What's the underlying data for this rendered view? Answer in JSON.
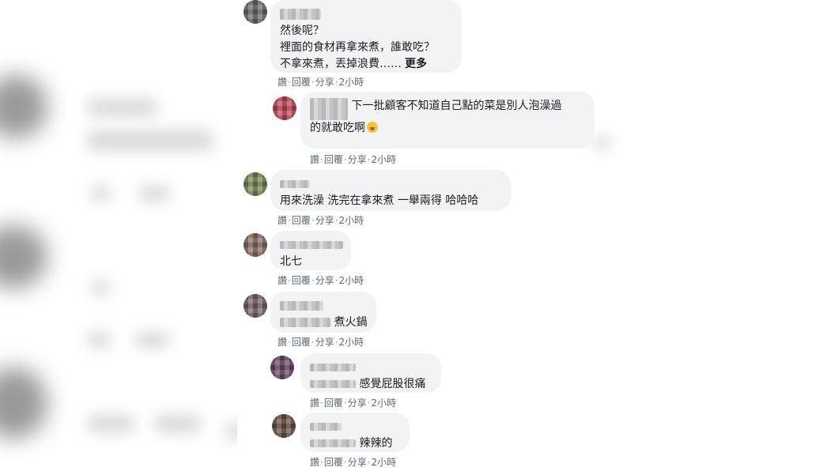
{
  "comments": [
    {
      "id": "c1",
      "lines": [
        "然後呢？",
        "裡面的食材再拿來煮，誰敢吃？",
        "不拿來煮，丟掉浪費……"
      ],
      "more": "更多",
      "actions": {
        "like": "讚",
        "reply": "回覆",
        "share": "分享",
        "time": "2小時"
      }
    },
    {
      "id": "c2",
      "lines": [
        "下一批顧客不知道自己點的菜是別人泡澡過",
        "的就敢吃啊"
      ],
      "actions": {
        "like": "讚",
        "reply": "回覆",
        "share": "分享",
        "time": "2小時"
      }
    },
    {
      "id": "c3",
      "lines": [
        "用來洗澡 洗完在拿來煮 一舉兩得 哈哈哈"
      ],
      "actions": {
        "like": "讚",
        "reply": "回覆",
        "share": "分享",
        "time": "2小時"
      }
    },
    {
      "id": "c4",
      "lines": [
        "北七"
      ],
      "actions": {
        "like": "讚",
        "reply": "回覆",
        "share": "分享",
        "time": "2小時"
      }
    },
    {
      "id": "c5",
      "lines": [
        "煮火鍋"
      ],
      "actions": {
        "like": "讚",
        "reply": "回覆",
        "share": "分享",
        "time": "2小時"
      }
    },
    {
      "id": "c6",
      "lines": [
        "感覺屁股很痛"
      ],
      "actions": {
        "like": "讚",
        "reply": "回覆",
        "share": "分享",
        "time": "2小時"
      }
    },
    {
      "id": "c7",
      "lines": [
        "辣辣的"
      ],
      "actions": {
        "like": "讚",
        "reply": "回覆",
        "share": "分享",
        "time": "2小時"
      }
    }
  ],
  "colors": {
    "bubble": "#f2f3f5",
    "action_text": "#606770",
    "text": "#1c1e21"
  },
  "icons": {
    "avatar": "user-avatar-pixelated",
    "emoji": "smiling-face-emoji"
  }
}
